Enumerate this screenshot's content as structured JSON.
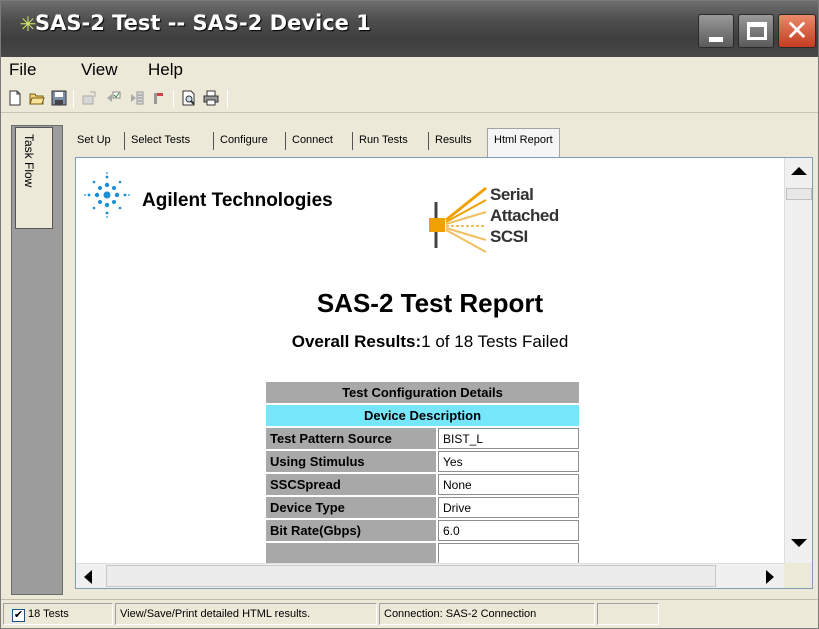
{
  "window": {
    "title": "SAS-2 Test -- SAS-2 Device 1",
    "close_glyph": "✕"
  },
  "menu": {
    "items": [
      "File",
      "View",
      "Help"
    ]
  },
  "toolbar": {
    "buttons": [
      "new-icon",
      "open-icon",
      "save-icon",
      "export-icon",
      "import-icon",
      "run-icon",
      "stop-icon",
      "print-preview-icon",
      "print-icon"
    ]
  },
  "taskflow": {
    "label": "Task Flow"
  },
  "tabs": [
    {
      "label": "Set Up"
    },
    {
      "label": "Select Tests"
    },
    {
      "label": "Configure"
    },
    {
      "label": "Connect"
    },
    {
      "label": "Run Tests"
    },
    {
      "label": "Results"
    },
    {
      "label": "Html Report",
      "active": true
    }
  ],
  "report": {
    "company": "Agilent Technologies",
    "sas_logo_lines": [
      "Serial",
      "Attached",
      "SCSI"
    ],
    "title": "SAS-2 Test Report",
    "overall_label": "Overall Results:",
    "overall_value": "1 of 18 Tests Failed",
    "table": {
      "header": "Test Configuration Details",
      "section": "Device Description",
      "rows": [
        {
          "label": "Test Pattern Source",
          "value": "BIST_L"
        },
        {
          "label": "Using Stimulus",
          "value": "Yes"
        },
        {
          "label": "SSCSpread",
          "value": "None"
        },
        {
          "label": "Device Type",
          "value": "Drive"
        },
        {
          "label": "Bit Rate(Gbps)",
          "value": "6.0"
        }
      ]
    }
  },
  "statusbar": {
    "tests_checked": true,
    "tests_label": "18 Tests",
    "hint": "View/Save/Print detailed HTML results.",
    "connection": "Connection: SAS-2 Connection",
    "extra": ""
  },
  "colors": {
    "section_header": "#76e6fa",
    "label_cell": "#a8a8a8",
    "close_button": "#c43c20",
    "agilent_logo": "#1a8fd6",
    "sas_logo": "#f0a000"
  }
}
